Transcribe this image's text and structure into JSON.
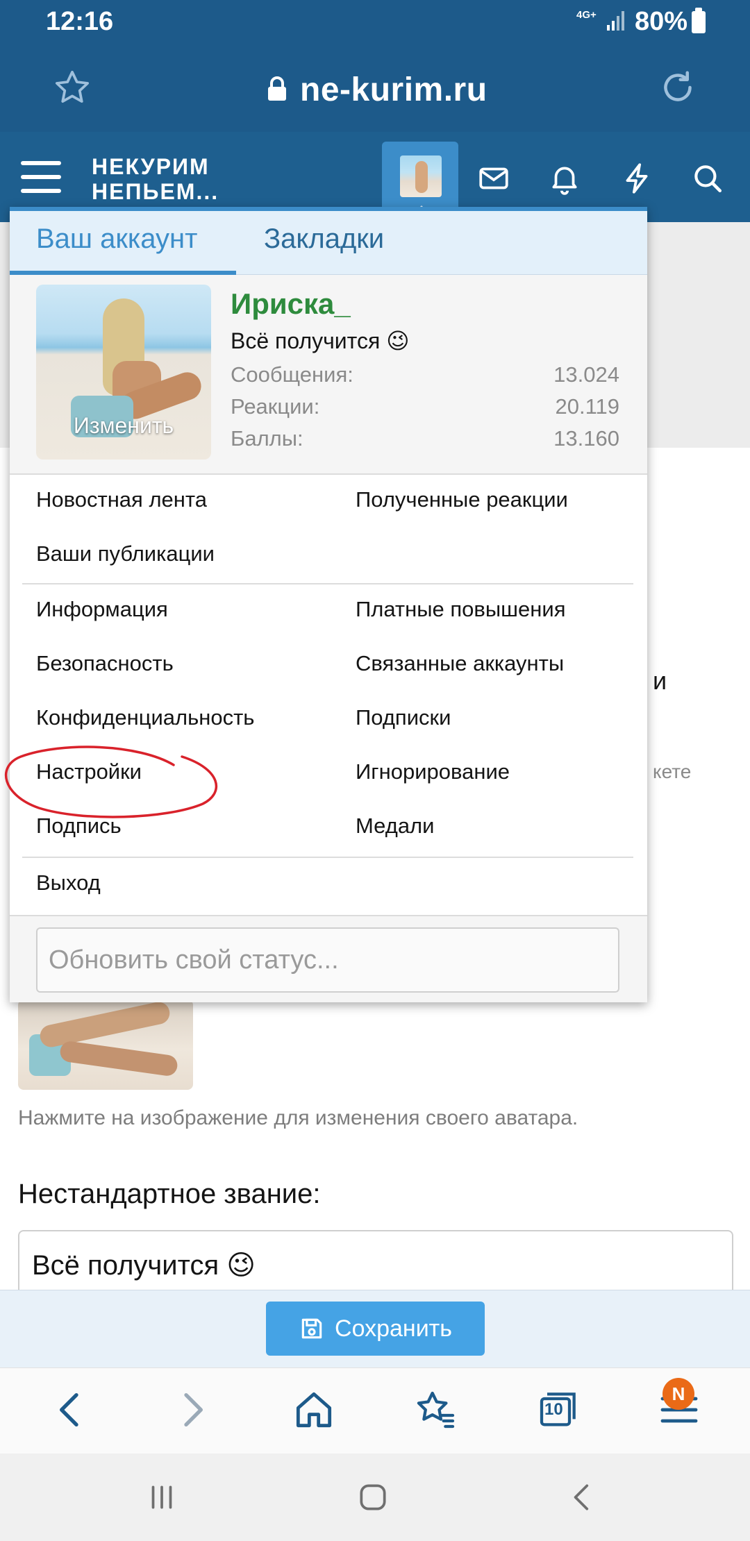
{
  "status_bar": {
    "time": "12:16",
    "network": "4G+",
    "battery": "80%"
  },
  "browser": {
    "url": "ne-kurim.ru"
  },
  "site_header": {
    "logo_line1": "НЕКУРИМ",
    "logo_line2": "НЕПЬЕМ..."
  },
  "account_menu": {
    "tabs": [
      "Ваш аккаунт",
      "Закладки"
    ],
    "active_tab": "Ваш аккаунт",
    "profile": {
      "username": "Ириска_",
      "user_title": "Всё получится 😉",
      "photo_change_label": "Изменить",
      "stats": [
        {
          "label": "Сообщения:",
          "value": "13.024"
        },
        {
          "label": "Реакции:",
          "value": "20.119"
        },
        {
          "label": "Баллы:",
          "value": "13.160"
        }
      ]
    },
    "links": {
      "news_feed": "Новостная лента",
      "received_reactions": "Полученные реакции",
      "your_content": "Ваши публикации",
      "information": "Информация",
      "paid_upgrades": "Платные повышения",
      "security": "Безопасность",
      "connected_accounts": "Связанные аккаунты",
      "privacy": "Конфиденциальность",
      "following": "Подписки",
      "preferences": "Настройки",
      "ignoring": "Игнорирование",
      "signature": "Подпись",
      "medals": "Медали",
      "logout": "Выход"
    },
    "status_placeholder": "Обновить свой статус..."
  },
  "page": {
    "right_fragment_1": "и",
    "right_fragment_2": "кете",
    "avatar_hint": "Нажмите на изображение для изменения своего аватара.",
    "custom_title_label": "Нестандартное звание:",
    "custom_title_value": "Всё получится 😉",
    "save_label": "Сохранить"
  },
  "bottom_toolbar": {
    "tabs_count": "10",
    "menu_badge": "N"
  },
  "colors": {
    "header_blue": "#1d5a8a",
    "accent_blue": "#3c8dc9",
    "username_green": "#2e8b3d",
    "annotation_red": "#d9222b",
    "badge_orange": "#ea6a17"
  }
}
